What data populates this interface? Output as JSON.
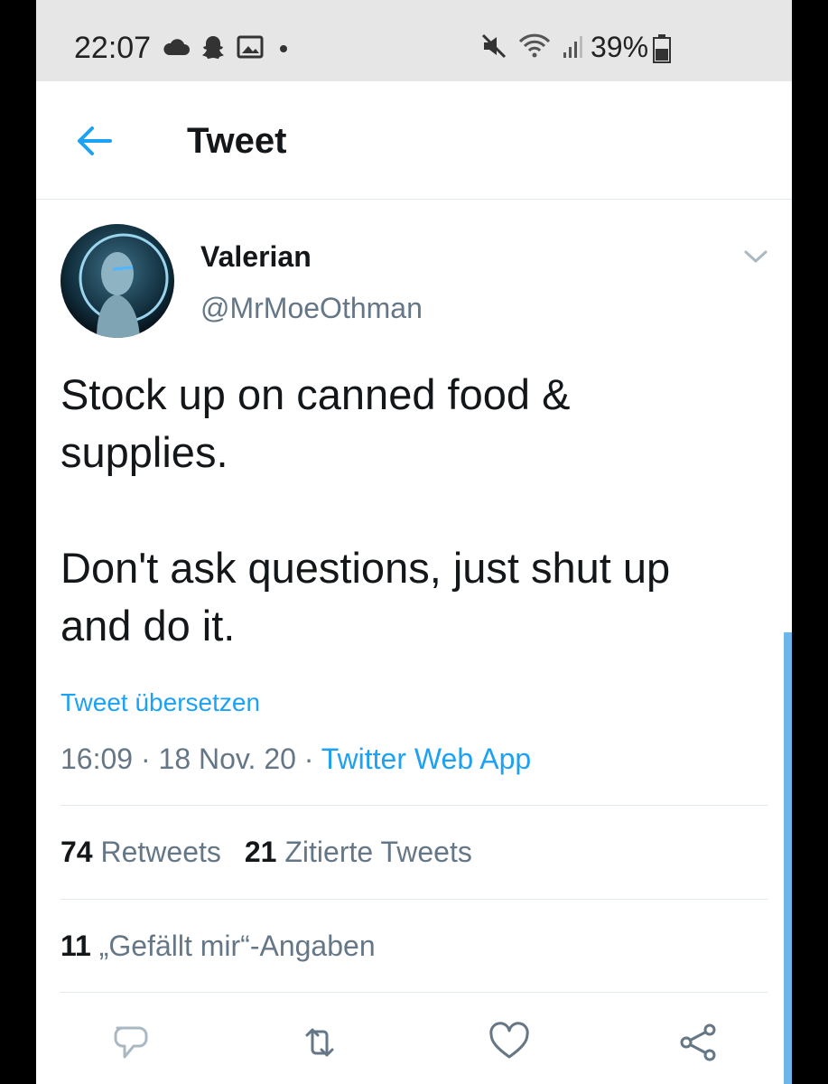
{
  "status_bar": {
    "time": "22:07",
    "battery": "39%",
    "left_icons": [
      "cloud-icon",
      "snapchat-icon",
      "image-icon",
      "dot-icon"
    ],
    "right_icons": [
      "mute-icon",
      "wifi-icon",
      "signal-icon",
      "battery-icon"
    ]
  },
  "header": {
    "title": "Tweet",
    "back_icon": "back-arrow-icon"
  },
  "tweet": {
    "name": "Valerian",
    "handle": "@MrMoeOthman",
    "text_para1_line1": "Stock up on canned food &",
    "text_para1_line2": "supplies.",
    "text_para2_line1": "Don't ask questions, just shut up",
    "text_para2_line2": "and do it.",
    "translate_label": "Tweet übersetzen",
    "time": "16:09",
    "date": "18 Nov. 20",
    "separator": "·",
    "app": "Twitter Web App"
  },
  "stats": {
    "retweets_count": "74",
    "retweets_label": "Retweets",
    "quotes_count": "21",
    "quotes_label": "Zitierte Tweets",
    "likes_count": "11",
    "likes_label": "„Gefällt mir“-Angaben"
  },
  "actions": [
    "reply-icon",
    "retweet-icon",
    "like-icon",
    "share-icon"
  ],
  "colors": {
    "accent": "#1da1f2",
    "text": "#14171a",
    "secondary": "#657786",
    "status_bar_bg": "#e6e6e6"
  }
}
